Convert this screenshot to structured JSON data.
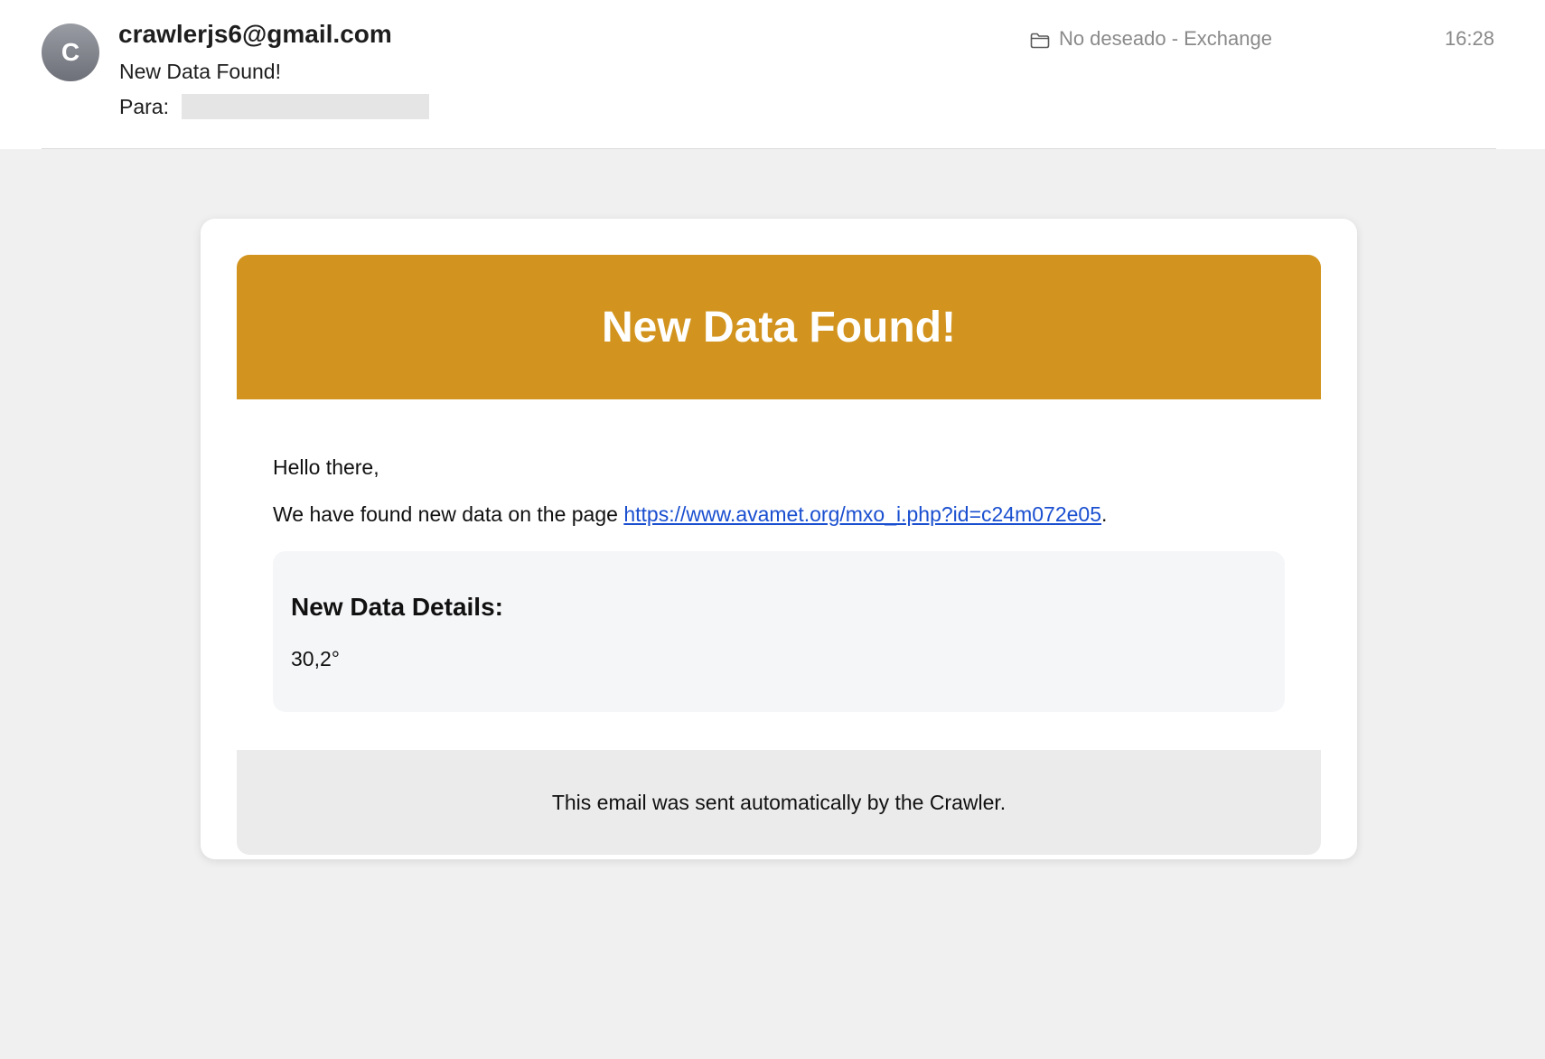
{
  "header": {
    "avatar_initial": "C",
    "sender": "crawlerjs6@gmail.com",
    "subject": "New Data Found!",
    "to_label": "Para:",
    "folder": "No deseado - Exchange",
    "time": "16:28"
  },
  "email": {
    "banner_title": "New Data Found!",
    "greeting": "Hello there,",
    "intro_prefix": "We have found new data on the page ",
    "link_text": "https://www.avamet.org/mxo_i.php?id=c24m072e05",
    "intro_suffix": ".",
    "details_title": "New Data Details:",
    "details_value": "30,2°",
    "footer_text": "This email was sent automatically by the Crawler."
  },
  "colors": {
    "banner": "#d2941e",
    "link": "#1a4fd0",
    "background": "#f0f0f0"
  },
  "icons": {
    "folder": "folder-icon"
  }
}
